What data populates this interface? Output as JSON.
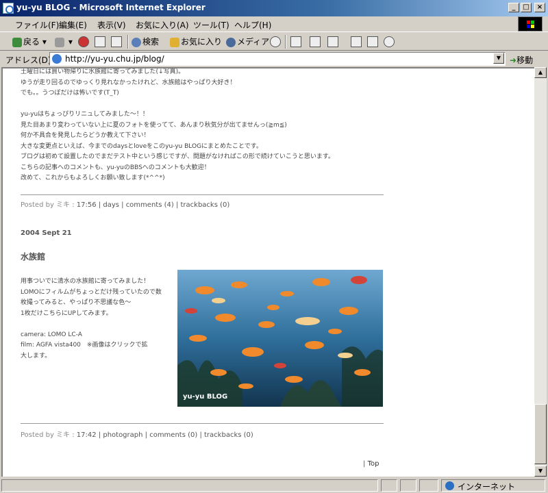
{
  "window": {
    "title": "yu-yu BLOG - Microsoft Internet Explorer"
  },
  "window_buttons": {
    "minimize": "_",
    "maximize": "□",
    "close": "×"
  },
  "menu": [
    "ファイル(F)",
    "編集(E)",
    "表示(V)",
    "お気に入り(A)",
    "ツール(T)",
    "ヘルプ(H)"
  ],
  "toolbar": {
    "back": "戻る",
    "search": "検索",
    "favorites": "お気に入り",
    "media": "メディア"
  },
  "address": {
    "label": "アドレス(D)",
    "url": "http://yu-yu.chu.jp/blog/",
    "go": "移動"
  },
  "post1": {
    "lines": [
      "土曜日には買い物帰りに水族館に寄ってみました(↓写真)。",
      "ゆうが走り回るのでゆっくり見れなかったけれど、水族館はやっぱり大好き！",
      "でも。。うつぼだけは怖いです(T_T)",
      "",
      "yu-yuはちょっぴりリニュしてみました～！！",
      "見た目あまり変わっていない上に夏のフォトを使ってて、あんまり秋気分が出てませんっ(≧m≦)",
      "何か不具合を発見したらどうか教えて下さい！",
      "大きな変更点といえば、今までのdaysとloveをこのyu-yu BLOGにまとめたことです。",
      "ブログは初めて設置したのでまだテスト中という感じですが、問題がなければこの形で続けていこうと思います。",
      "こちらの記事へのコメントも、yu-yuのBBSへのコメントも大歓迎！",
      "改めて、これからもよろしくお願い致します(*^^*)"
    ],
    "meta": {
      "posted_by": "Posted by ミキ :",
      "time": "17:56",
      "category": "days",
      "comments": "comments (4)",
      "trackbacks": "trackbacks (0)"
    }
  },
  "post2": {
    "date": "2004 Sept 21",
    "title": "水族館",
    "lines": [
      "用事ついでに清水の水族館に寄ってみました！",
      "LOMOにフィルムがちょっとだけ残っていたので数",
      "枚撮ってみると、やっぱり不思議な色～",
      "1枚だけこちらにUPしてみます。",
      "",
      "camera: LOMO LC-A",
      "film: AGFA vista400　※画像はクリックで拡",
      "大します。"
    ],
    "photo_watermark": "yu-yu BLOG",
    "meta": {
      "posted_by": "Posted by ミキ :",
      "time": "17:42",
      "category": "photograph",
      "comments": "comments (0)",
      "trackbacks": "trackbacks (0)"
    }
  },
  "footer": {
    "sep": "|",
    "top_link": "Top"
  },
  "status": {
    "zone": "インターネット"
  },
  "colors": {
    "title_gradient_start": "#0a246a",
    "chrome": "#d4d0c8",
    "water": "#2f6f9c"
  }
}
